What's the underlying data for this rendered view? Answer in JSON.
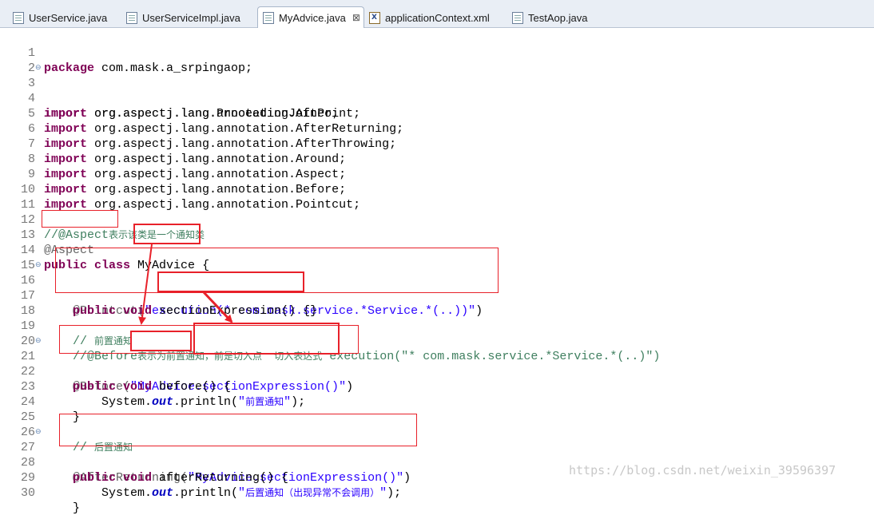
{
  "tabs": [
    {
      "label": "UserService.java",
      "icon": "java-file-icon",
      "active": false
    },
    {
      "label": "UserServiceImpl.java",
      "icon": "java-file-icon",
      "active": false
    },
    {
      "label": "MyAdvice.java",
      "icon": "java-file-icon",
      "active": true,
      "close": "⊠"
    },
    {
      "label": "applicationContext.xml",
      "icon": "xml-file-icon",
      "active": false
    },
    {
      "label": "TestAop.java",
      "icon": "java-file-icon",
      "active": false
    }
  ],
  "line_numbers": [
    "1",
    "2",
    "3",
    "4",
    "5",
    "6",
    "7",
    "8",
    "9",
    "10",
    "11",
    "12",
    "13",
    "14",
    "15",
    "16",
    "17",
    "18",
    "19",
    "20",
    "21",
    "22",
    "23",
    "24",
    "25",
    "26",
    "27",
    "28",
    "29",
    "30"
  ],
  "code": {
    "l1_kw": "package",
    "l1_rest": " com.mask.a_srpingaop;",
    "import_kw": "import",
    "l3": " org.aspectj.lang.ProceedingJoinPoint;",
    "l4": " org.aspectj.lang.annotation.After;",
    "l5": " org.aspectj.lang.annotation.AfterReturning;",
    "l6": " org.aspectj.lang.annotation.AfterThrowing;",
    "l7": " org.aspectj.lang.annotation.Around;",
    "l8": " org.aspectj.lang.annotation.Aspect;",
    "l9": " org.aspectj.lang.annotation.Before;",
    "l10": " org.aspectj.lang.annotation.Pointcut;",
    "l12_slash": "//@Aspect",
    "l12_cjk": "表示该类是一个通知类",
    "l13": "@Aspect",
    "l14_kw": "public class",
    "l14_name": "MyAdvice",
    "l14_brace": " {",
    "l16_ann": "@Pointcut(",
    "l16_str": "\"execution(* com.mask.service.*Service.*(..))\"",
    "l16_end": ")",
    "l17_kw": "public void",
    "l17_method": "sectionExpression()",
    "l17_body": " {}",
    "l19_slash": "// ",
    "l19_cjk": "前置通知",
    "l20_slash": "//@Before",
    "l20_cjk": "表示为前置通知，前是切入点    切入表达式",
    "l20_rest": " execution(\"* com.mask.service.*Service.*(..)\")",
    "l21_ann": "@Before(",
    "l21_str1": "\"MyAdvice",
    "l21_str2": ".sectionExpression()",
    "l21_str3": "\"",
    "l21_end": ")",
    "l22_kw": "public void",
    "l22_rest": " before() {",
    "l23_a": "System.",
    "l23_out": "out",
    "l23_b": ".println(",
    "l23_q1": "\"",
    "l23_cjk": "前置通知",
    "l23_q2": "\"",
    "l23_c": ");",
    "l24": "}",
    "l26_slash": "// ",
    "l26_cjk": "后置通知",
    "l27_ann": "@AfterReturning(",
    "l27_str": "\"MyAdvice.sectionExpression()\"",
    "l27_end": ")",
    "l28_kw": "public void",
    "l28_rest": " afterReturning() {",
    "l29_a": "System.",
    "l29_out": "out",
    "l29_b": ".println(",
    "l29_q1": "\"",
    "l29_cjk": "后置通知（出现异常不会调用）",
    "l29_q2": "\"",
    "l29_c": ");",
    "l30": "}"
  },
  "watermark": "https://blog.csdn.net/weixin_39596397",
  "colors": {
    "keyword": "#7f0055",
    "string": "#2a00ff",
    "comment": "#3f7f5f",
    "annotation": "#646464",
    "highlight_box": "#e8212a"
  }
}
